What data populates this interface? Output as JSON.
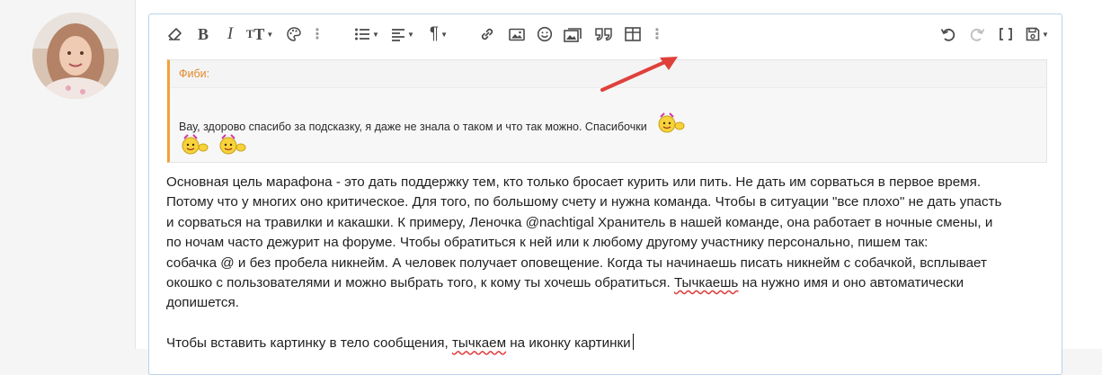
{
  "toolbar": {
    "icons": [
      "eraser-icon",
      "bold-icon",
      "italic-icon",
      "text-size-icon",
      "palette-icon",
      "more-icon",
      "list-icon",
      "align-icon",
      "paragraph-icon",
      "link-icon",
      "image-icon",
      "smiley-icon",
      "media-icon",
      "quote-icon",
      "table-icon",
      "more-icon",
      "undo-icon",
      "redo-icon",
      "brackets-icon",
      "save-draft-icon"
    ]
  },
  "quote": {
    "author": "Фиби:",
    "text": "Вау, здорово спасибо за подсказку, я даже не знала о таком и что так можно. Спасибочки"
  },
  "content": {
    "lines": [
      "Основная цель марафона - это дать поддержку тем, кто только бросает курить или пить. Не дать им сорваться в первое время.",
      "Потому что у многих оно критическое. Для того, по большому счету и нужна команда. Чтобы в ситуации \"все плохо\" не дать упасть",
      "и сорваться на травилки и какашки. К примеру, Леночка @nachtigal Хранитель в нашей команде, она работает в ночные смены, и",
      "по ночам часто дежурит на форуме. Чтобы обратиться к ней или к любому другому участнику персонально, пишем так:",
      "собачка @ и без пробела никнейм. А человек получает оповещение. Когда ты начинаешь писать никнейм с собачкой, всплывает"
    ],
    "line6_pre": "окошко с пользователями и можно выбрать того, к кому ты хочешь обратиться.",
    "line6_squiggle": "Тычкаешь",
    "line6_post": "на нужно имя и оно автоматически",
    "line7": "допишется.",
    "line8_pre": "Чтобы вставить картинку в тело сообщения,",
    "line8_squiggle": "тычкаем",
    "line8_post": "на иконку картинки"
  },
  "colors": {
    "accent": "#f0a33a",
    "arrow": "#e0403a",
    "border": "#b9d3ea"
  }
}
